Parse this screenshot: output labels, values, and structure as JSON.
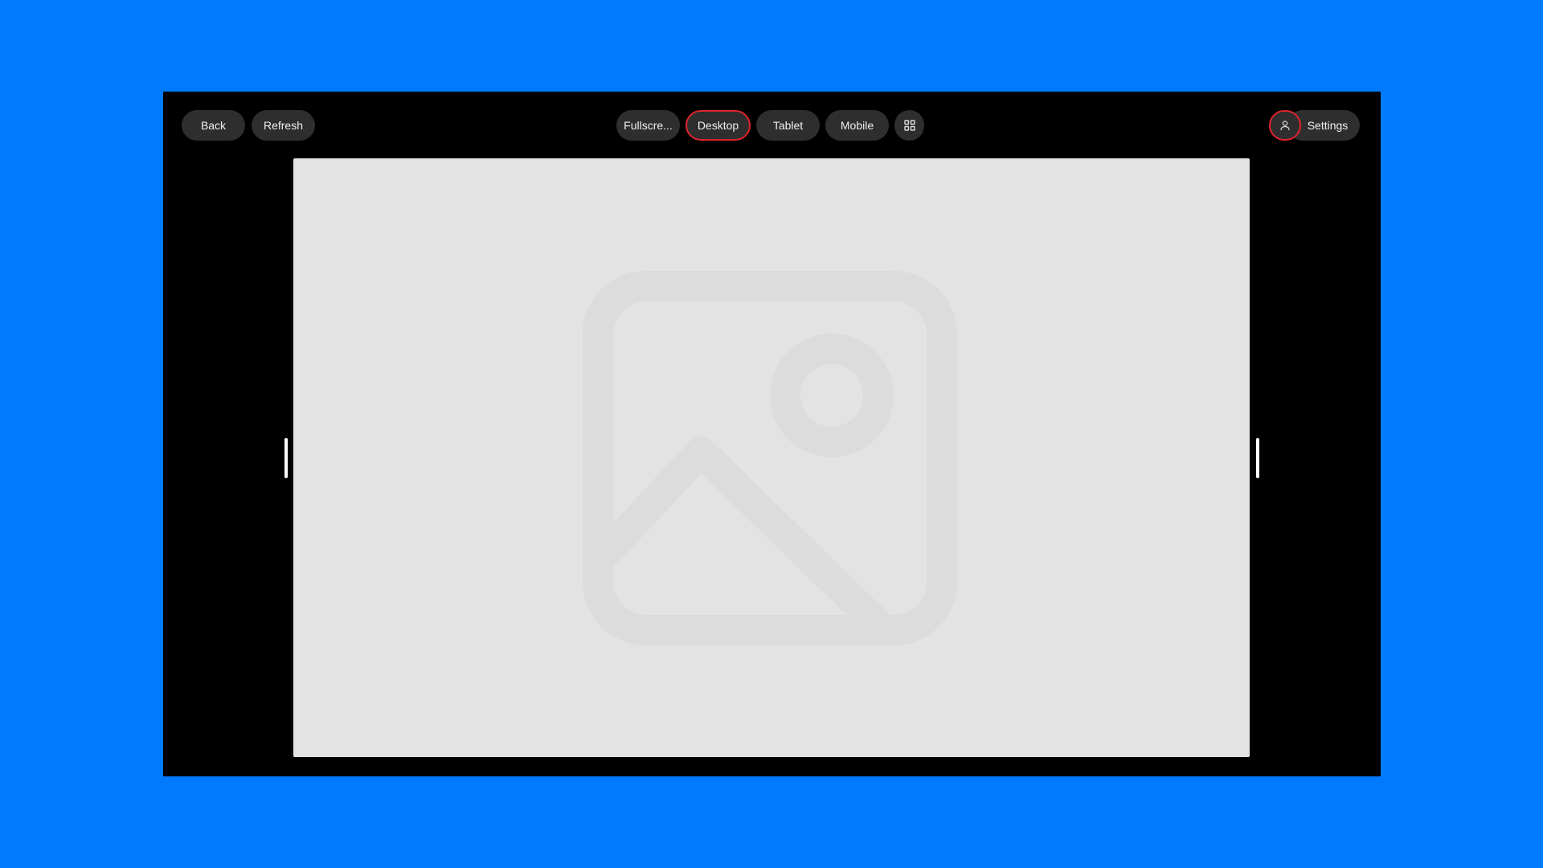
{
  "toolbar": {
    "back_label": "Back",
    "refresh_label": "Refresh",
    "fullscreen_label": "Fullscre...",
    "desktop_label": "Desktop",
    "tablet_label": "Tablet",
    "mobile_label": "Mobile",
    "grid_icon": "grid-icon",
    "user_icon": "user-icon",
    "settings_label": "Settings",
    "selected_view": "Desktop"
  },
  "preview": {
    "placeholder_icon": "image-placeholder-icon"
  },
  "colors": {
    "background": "#007AFF",
    "window": "#000000",
    "pill": "#2e2e2e",
    "selected_outline": "#e0242b",
    "preview_bg": "#e3e3e3"
  }
}
